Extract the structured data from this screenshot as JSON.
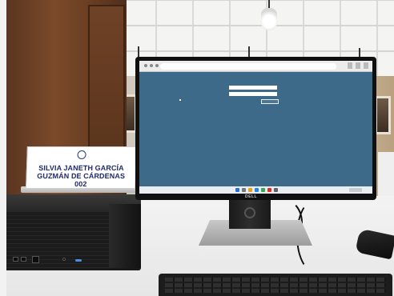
{
  "nameplate": {
    "line1": "SILVIA JANETH GARCÍA",
    "line2": "GUZMÁN DE CÁRDENAS",
    "seat": "002"
  },
  "monitor": {
    "brand": "DELL"
  },
  "colors": {
    "screen_background": "#3e6a8a",
    "nameplate_text": "#1f2a6a",
    "wood": "#6a3e22"
  },
  "icons": {
    "nameplate_emblem": "circle-emblem-icon",
    "power_led": "power-led-icon"
  }
}
